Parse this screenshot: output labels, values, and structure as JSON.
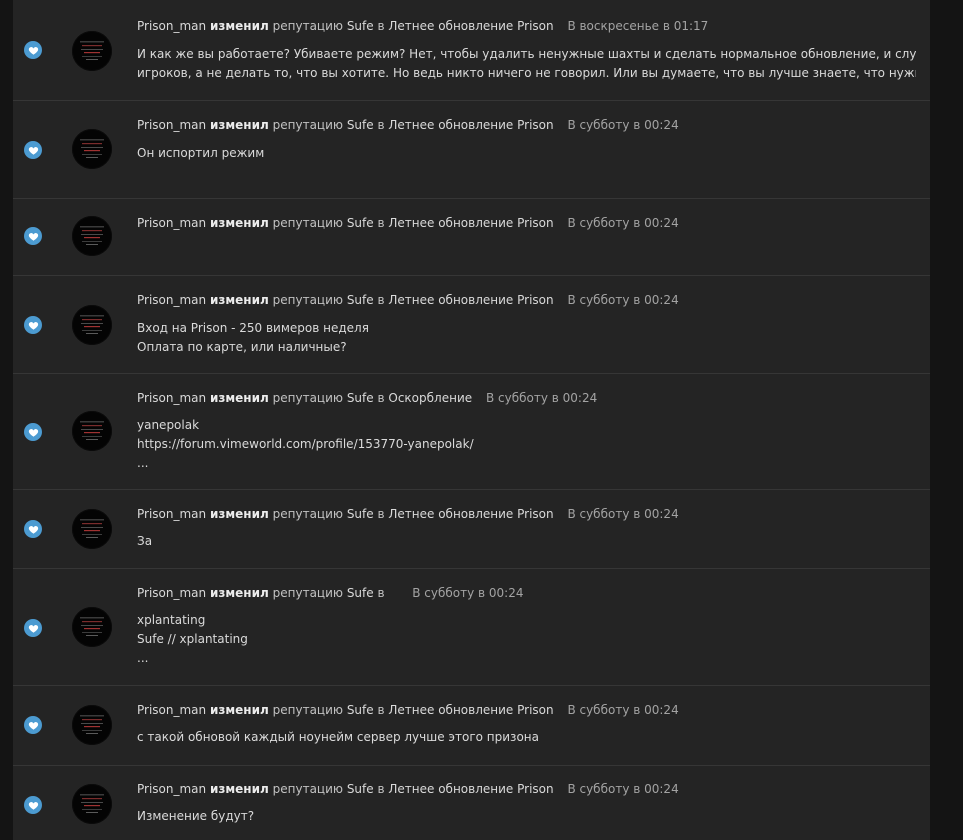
{
  "feed": {
    "items": [
      {
        "user": "Prison_man",
        "verb": "изменил",
        "middle": "репутацию",
        "target": "Sufe",
        "preposition": "в",
        "topic": "Летнее обновление Prison",
        "time": "В воскресенье в 01:17",
        "lines": [
          "И как же вы работаете? Убиваете режим? Нет, чтобы удалить ненужные шахты и сделать нормальное обновление, и слушать мнение",
          "игроков, а не делать то, что вы хотите. Но ведь никто ничего не говорил. Или вы думаете, что вы лучше знаете, что нужно добавить..."
        ]
      },
      {
        "user": "Prison_man",
        "verb": "изменил",
        "middle": "репутацию",
        "target": "Sufe",
        "preposition": "в",
        "topic": "Летнее обновление Prison",
        "time": "В субботу в 00:24",
        "lines": [
          "Он испортил режим"
        ]
      },
      {
        "user": "Prison_man",
        "verb": "изменил",
        "middle": "репутацию",
        "target": "Sufe",
        "preposition": "в",
        "topic": "Летнее обновление Prison",
        "time": "В субботу в 00:24",
        "lines": []
      },
      {
        "user": "Prison_man",
        "verb": "изменил",
        "middle": "репутацию",
        "target": "Sufe",
        "preposition": "в",
        "topic": "Летнее обновление Prison",
        "time": "В субботу в 00:24",
        "lines": [
          "Вход на Prison - 250 вимеров неделя",
          "Оплата по карте, или наличные?"
        ]
      },
      {
        "user": "Prison_man",
        "verb": "изменил",
        "middle": "репутацию",
        "target": "Sufe",
        "preposition": "в",
        "topic": "Оскорбление",
        "time": "В субботу в 00:24",
        "lines": [
          "yanepolak",
          "https://forum.vimeworld.com/profile/153770-yanepolak/",
          "..."
        ]
      },
      {
        "user": "Prison_man",
        "verb": "изменил",
        "middle": "репутацию",
        "target": "Sufe",
        "preposition": "в",
        "topic": "Летнее обновление Prison",
        "time": "В субботу в 00:24",
        "lines": [
          "За"
        ]
      },
      {
        "user": "Prison_man",
        "verb": "изменил",
        "middle": "репутацию",
        "target": "Sufe",
        "preposition": "в",
        "topic": "",
        "time": "В субботу в 00:24",
        "lines": [
          "xplantating",
          "Sufe // xplantating",
          "..."
        ]
      },
      {
        "user": "Prison_man",
        "verb": "изменил",
        "middle": "репутацию",
        "target": "Sufe",
        "preposition": "в",
        "topic": "Летнее обновление Prison",
        "time": "В субботу в 00:24",
        "lines": [
          "с такой обновой каждый ноунейм сервер лучше этого призона"
        ]
      },
      {
        "user": "Prison_man",
        "verb": "изменил",
        "middle": "репутацию",
        "target": "Sufe",
        "preposition": "в",
        "topic": "Летнее обновление Prison",
        "time": "В субботу в 00:24",
        "lines": [
          "Изменение будут?"
        ]
      }
    ]
  },
  "icons": {
    "reaction": "heart-icon",
    "reaction_color": "#4c9bd1"
  }
}
